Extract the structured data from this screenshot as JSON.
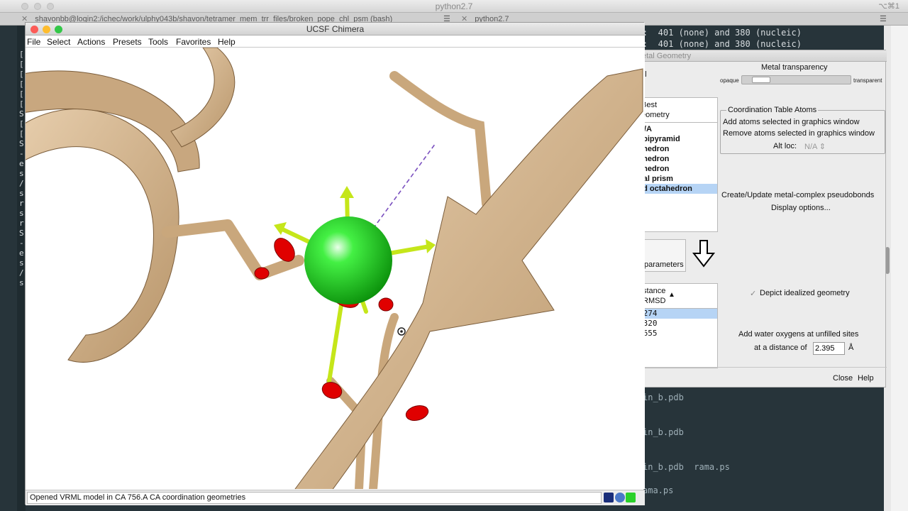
{
  "terminal": {
    "window_title": "python2.7",
    "shortcut": "⌥⌘1",
    "tab_left": "shavonbb@login2:/ichec/work/ulphy043b/shavon/tetramer_mem_trr_files/broken_pope_chl_psm (bash)",
    "tab_right": "python2.7",
    "lines_top": [
      ":  401 (none) and 380 (nucleic)",
      ":  401 (none) and 380 (nucleic)"
    ],
    "lines_bottom": [
      "in_b.pdb",
      "in_b.pdb",
      "in_b.pdb  rama.ps",
      "ama.ps"
    ],
    "left_gutter": [
      "[",
      "[",
      "[",
      "[",
      "[",
      "[",
      "S",
      "[",
      "[",
      "S",
      "-",
      "e",
      "s",
      "/",
      "s",
      "r",
      "s",
      "r",
      "S",
      "-",
      "e",
      "s",
      "/",
      "s"
    ]
  },
  "metal_geometry": {
    "title": "etal Geometry",
    "partial_label": "al",
    "metal_transparency_label": "Metal transparency",
    "opaque_label": "opaque",
    "transparent_label": "transparent",
    "transparency_value": 0.1,
    "best_geometry_header": [
      "Best",
      "eometry"
    ],
    "geometry_rows": [
      {
        "label": "N/A",
        "selected": false
      },
      {
        "label": "l bipyramid",
        "selected": false
      },
      {
        "label": "ahedron",
        "selected": false
      },
      {
        "label": "ahedron",
        "selected": false
      },
      {
        "label": "ahedron",
        "selected": false
      },
      {
        "label": "nal prism",
        "selected": false
      },
      {
        "label": "ed octahedron",
        "selected": true
      }
    ],
    "coord_table_title": "Coordination Table Atoms",
    "add_atoms_button": "Add atoms selected in graphics window",
    "remove_atoms_button": "Remove atoms selected in graphics window",
    "alt_loc_label": "Alt loc:",
    "alt_loc_value": "N/A",
    "create_pseudobonds_button": "Create/Update metal-complex pseudobonds",
    "display_options_button": "Display options...",
    "parameters_button": "parameters",
    "paren": ")",
    "rmsd_header": [
      "stance",
      "RMSD"
    ],
    "sort_arrow": "▲",
    "rmsd_rows": [
      {
        "label": ".274",
        "selected": true
      },
      {
        "label": ".320",
        "selected": false
      },
      {
        "label": ".655",
        "selected": false
      }
    ],
    "depict_idealized_label": "Depict idealized geometry",
    "depict_checked": true,
    "checkmark": "✓",
    "add_water_label": "Add water oxygens at unfilled sites",
    "distance_label": "at a distance of",
    "distance_value": "2.395",
    "distance_unit": "Å",
    "close_button": "Close",
    "help_button": "Help"
  },
  "chimera": {
    "window_title": "UCSF Chimera",
    "menu": [
      "File",
      "Select",
      "Actions",
      "Presets",
      "Tools",
      "Favorites",
      "Help"
    ],
    "status_message": "Opened VRML model in CA 756.A CA coordination geometries",
    "colors": {
      "ribbon": "#d6b892",
      "ribbon_dark": "#a8875f",
      "metal": "#22e022",
      "oxygen": "#e00000",
      "vector": "#c5e61a",
      "pseudobond": "#7a4fbf"
    }
  }
}
